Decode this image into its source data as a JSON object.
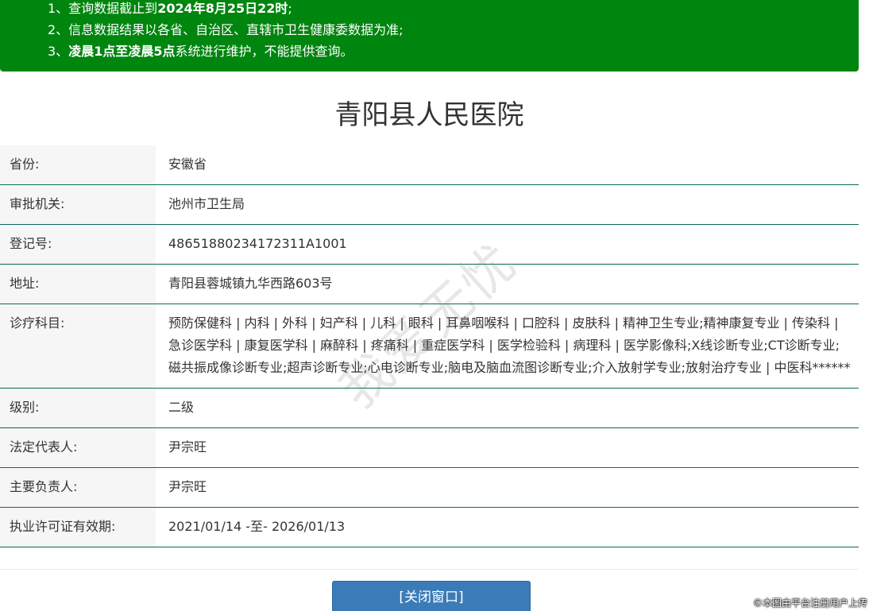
{
  "notice": {
    "line1_prefix": "1、查询数据截止到",
    "line1_bold": "2024年8月25日22时",
    "line1_suffix": ";",
    "line2": "2、信息数据结果以各省、自治区、直辖市卫生健康委数据为准;",
    "line3_prefix": "3、",
    "line3_bold": "凌晨1点至凌晨5点",
    "line3_suffix": "系统进行维护，不能提供查询。"
  },
  "title": "青阳县人民医院",
  "rows": [
    {
      "label": "省份:",
      "value": "安徽省"
    },
    {
      "label": "审批机关:",
      "value": "池州市卫生局"
    },
    {
      "label": "登记号:",
      "value": "48651880234172311A1001"
    },
    {
      "label": "地址:",
      "value": "青阳县蓉城镇九华西路603号"
    },
    {
      "label": "诊疗科目:",
      "value": "预防保健科 | 内科 | 外科 | 妇产科 | 儿科 | 眼科 | 耳鼻咽喉科 | 口腔科 | 皮肤科 | 精神卫生专业;精神康复专业 | 传染科 | 急诊医学科 | 康复医学科 | 麻醉科 | 疼痛科 | 重症医学科 | 医学检验科 | 病理科 | 医学影像科;X线诊断专业;CT诊断专业;磁共振成像诊断专业;超声诊断专业;心电诊断专业;脑电及脑血流图诊断专业;介入放射学专业;放射治疗专业 | 中医科******"
    },
    {
      "label": "级别:",
      "value": "二级"
    },
    {
      "label": "法定代表人:",
      "value": "尹宗旺"
    },
    {
      "label": "主要负责人:",
      "value": "尹宗旺"
    },
    {
      "label": "执业许可证有效期:",
      "value": "2021/01/14 -至- 2026/01/13"
    }
  ],
  "close_button_label": "[关闭窗口]",
  "watermark": "我爱无忧",
  "corner_note": "©本图由平台注册用户上传"
}
